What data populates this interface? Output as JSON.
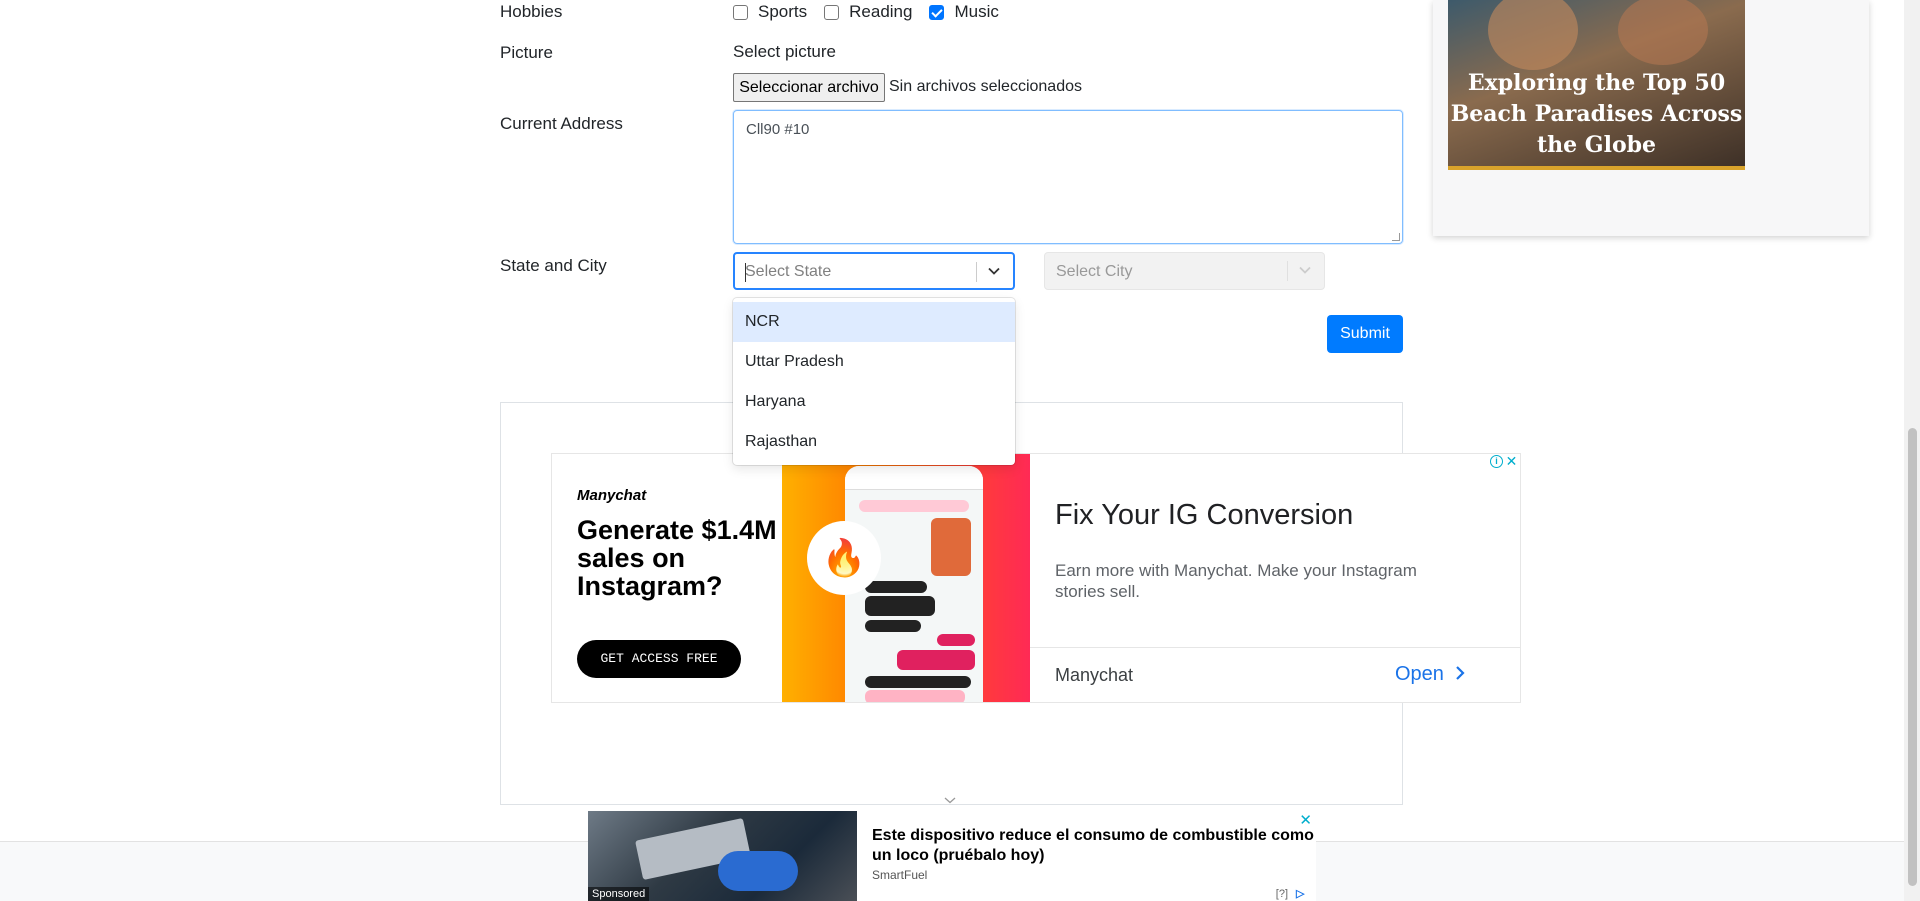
{
  "form": {
    "hobbies_label": "Hobbies",
    "hobbies": [
      {
        "label": "Sports",
        "checked": false
      },
      {
        "label": "Reading",
        "checked": false
      },
      {
        "label": "Music",
        "checked": true
      }
    ],
    "picture_label": "Picture",
    "select_picture": "Select picture",
    "file_button": "Seleccionar archivo",
    "file_status": "Sin archivos seleccionados",
    "address_label": "Current Address",
    "address_value": "Cll90 #10",
    "state_city_label": "State and City",
    "state_placeholder": "Select State",
    "city_placeholder": "Select City",
    "state_options": [
      "NCR",
      "Uttar Pradesh",
      "Haryana",
      "Rajasthan"
    ],
    "submit": "Submit",
    "accent": "#007bff"
  },
  "ad_instagram": {
    "brand": "Manychat",
    "headline": "Generate $1.4M sales on Instagram?",
    "cta": "GET ACCESS FREE",
    "title": "Fix Your IG Conversion",
    "description": "Earn more with Manychat. Make your Instagram stories sell.",
    "advertiser": "Manychat",
    "open_label": "Open"
  },
  "ad_side": {
    "title": "Exploring the Top 50 Beach Paradises Across the Globe"
  },
  "ad_native": {
    "sponsored": "Sponsored",
    "title": "Este dispositivo reduce el consumo de combustible como un loco (pruébalo hoy)",
    "brand": "SmartFuel",
    "help": "[?]"
  }
}
